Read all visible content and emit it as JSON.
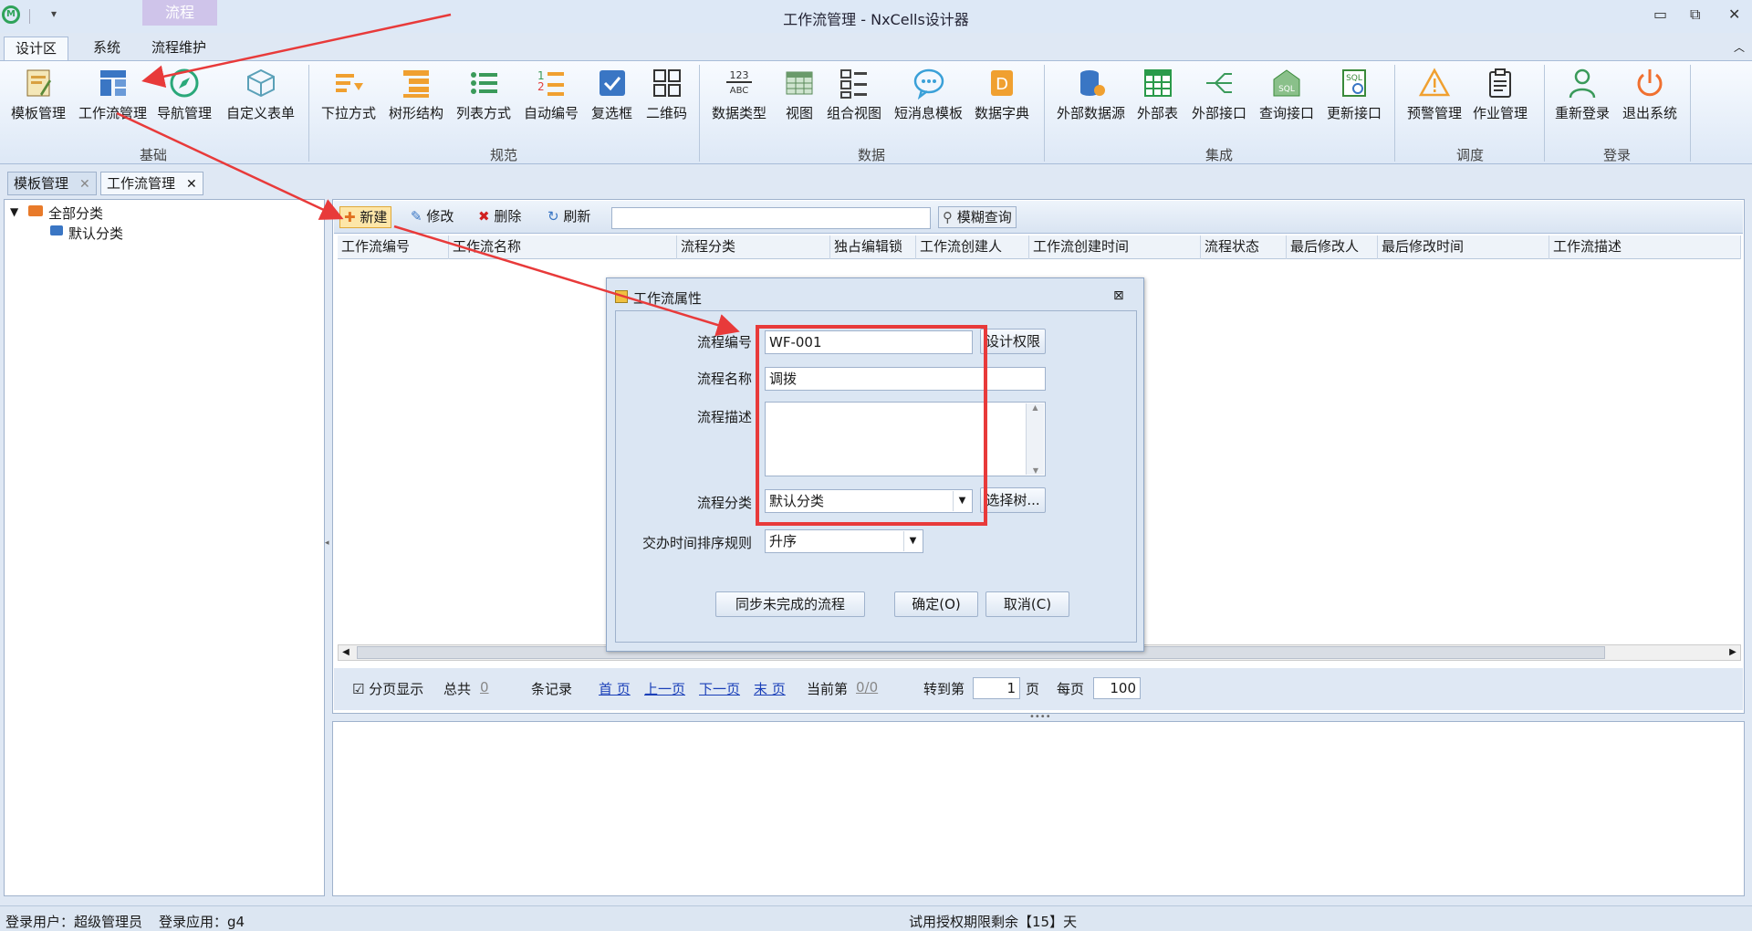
{
  "window": {
    "title": "工作流管理 - NxCells设计器",
    "context_tab": "流程"
  },
  "ribbon": {
    "tabs": [
      "设计区",
      "系统",
      "流程维护"
    ],
    "groups": [
      {
        "label": "基础",
        "items": [
          "模板管理",
          "工作流管理",
          "导航管理",
          "自定义表单"
        ]
      },
      {
        "label": "规范",
        "items": [
          "下拉方式",
          "树形结构",
          "列表方式",
          "自动编号",
          "复选框",
          "二维码"
        ]
      },
      {
        "label": "数据",
        "items": [
          "数据类型",
          "视图",
          "组合视图",
          "短消息模板",
          "数据字典"
        ]
      },
      {
        "label": "集成",
        "items": [
          "外部数据源",
          "外部表",
          "外部接口",
          "查询接口",
          "更新接口"
        ]
      },
      {
        "label": "调度",
        "items": [
          "预警管理",
          "作业管理"
        ]
      },
      {
        "label": "登录",
        "items": [
          "重新登录",
          "退出系统"
        ]
      }
    ],
    "icon_123": "123",
    "icon_abc": "ABC",
    "icon_sql": "SQL"
  },
  "doc_tabs": [
    "模板管理",
    "工作流管理"
  ],
  "tree": {
    "root": "全部分类",
    "child": "默认分类"
  },
  "toolbar": {
    "new": "新建",
    "edit": "修改",
    "delete": "删除",
    "refresh": "刷新",
    "search_value": "",
    "fuzzy": "模糊查询"
  },
  "grid": {
    "columns": [
      "工作流编号",
      "工作流名称",
      "流程分类",
      "独占编辑锁",
      "工作流创建人",
      "工作流创建时间",
      "流程状态",
      "最后修改人",
      "最后修改时间",
      "工作流描述"
    ]
  },
  "pager": {
    "paged": "分页显示",
    "total": "总共",
    "total_count": "0",
    "records": "条记录",
    "first": "首 页",
    "prev": "上一页",
    "next": "下一页",
    "last": "末 页",
    "current": "当前第",
    "current_val": "0/0",
    "goto": "转到第",
    "goto_val": "1",
    "page": "页",
    "per_page": "每页",
    "per_page_val": "100"
  },
  "dialog": {
    "title": "工作流属性",
    "code_label": "流程编号",
    "code_value": "WF-001",
    "perm_button": "设计权限",
    "name_label": "流程名称",
    "name_value": "调拨",
    "desc_label": "流程描述",
    "desc_value": "",
    "cat_label": "流程分类",
    "cat_value": "默认分类",
    "select_tree": "选择树...",
    "sort_label": "交办时间排序规则",
    "sort_value": "升序",
    "sync_button": "同步未完成的流程",
    "ok_button": "确定(O)",
    "cancel_button": "取消(C)"
  },
  "status": {
    "user": "登录用户：超级管理员",
    "app": "登录应用：g4",
    "trial": "试用授权期限剩余【15】天"
  },
  "colors": {
    "accent_red": "#e83a3a",
    "ribbon_blue": "#3a76c4",
    "tree_folder": "#e87a2a"
  }
}
